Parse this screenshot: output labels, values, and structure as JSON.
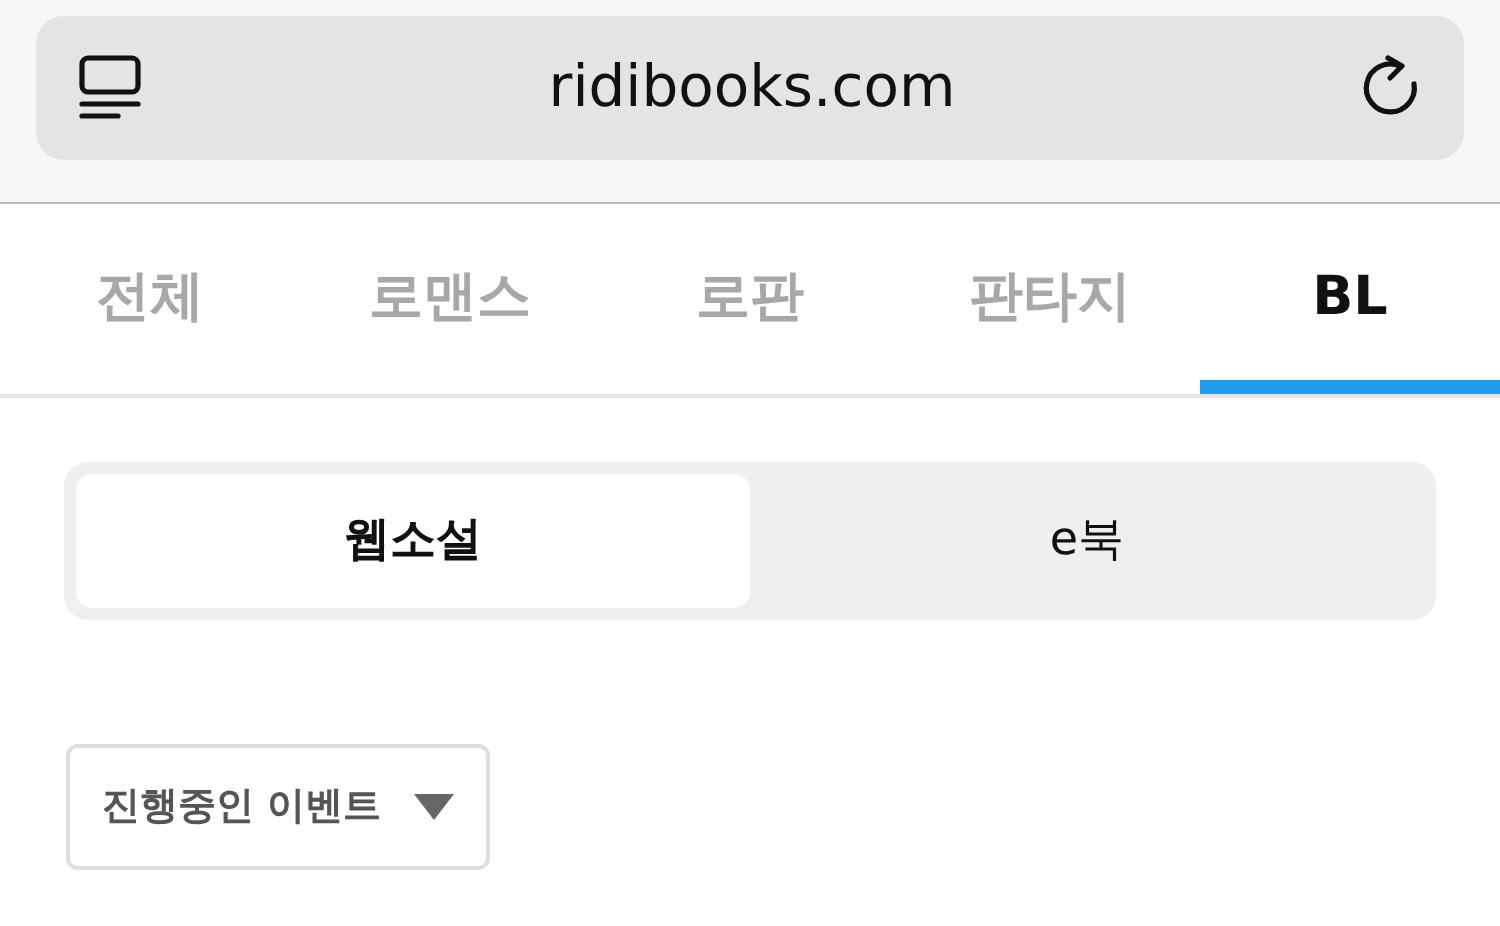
{
  "address_bar": {
    "url": "ridibooks.com"
  },
  "tabs": [
    {
      "label": "전체",
      "selected": false
    },
    {
      "label": "로맨스",
      "selected": false
    },
    {
      "label": "로판",
      "selected": false
    },
    {
      "label": "판타지",
      "selected": false
    },
    {
      "label": "BL",
      "selected": true
    }
  ],
  "segments": [
    {
      "label": "웹소설",
      "selected": true
    },
    {
      "label": "e북",
      "selected": false
    }
  ],
  "filter": {
    "label": "진행중인 이벤트"
  }
}
